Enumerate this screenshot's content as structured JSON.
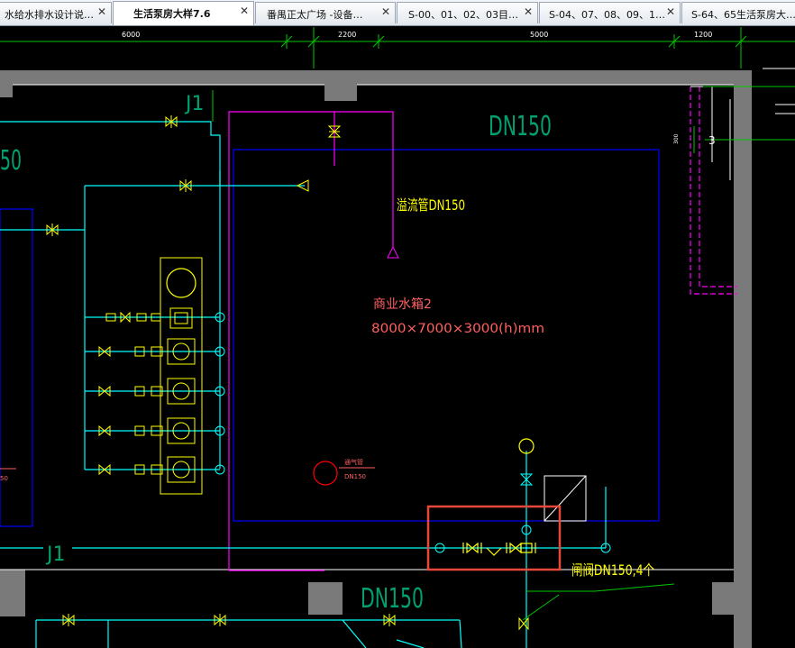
{
  "tabs": [
    {
      "label": "水给水排水设计说…",
      "active": false
    },
    {
      "label": "生活泵房大样7.6",
      "active": true
    },
    {
      "label": "番禺正太广场 -设备…",
      "active": false
    },
    {
      "label": "S-00、01、02、03目…",
      "active": false
    },
    {
      "label": "S-04、07、08、09、1…",
      "active": false
    },
    {
      "label": "S-64、65生活泵房大…",
      "active": false
    }
  ],
  "close_glyph": "✕",
  "dimensions": [
    "6000",
    "2200",
    "5000",
    "1200"
  ],
  "drawing": {
    "dn150_top": "DN150",
    "dn150_left_partial": "50",
    "dn150_bottom": "DN150",
    "overflow_pipe": "溢流管DN150",
    "tank_name": "商业水箱2",
    "tank_size": "8000×7000×3000(h)mm",
    "vent_pipe": "通气管",
    "vent_dn": "DN150",
    "pipe_j1_top": "J1",
    "pipe_j1": "J1",
    "gate_valve_note": "闸阀DN150,4个",
    "right_number": "3",
    "right_small": "300",
    "left_partial_small": "50"
  },
  "colors": {
    "cyan": "#00ffff",
    "magenta": "#ff00ff",
    "yellow": "#ffff00",
    "blue": "#0000ff",
    "green": "#00c800",
    "teal_text": "#00a070",
    "red": "#ff0000",
    "highlight": "#e8473b",
    "wall": "#808080",
    "text_red": "#ff6060"
  }
}
